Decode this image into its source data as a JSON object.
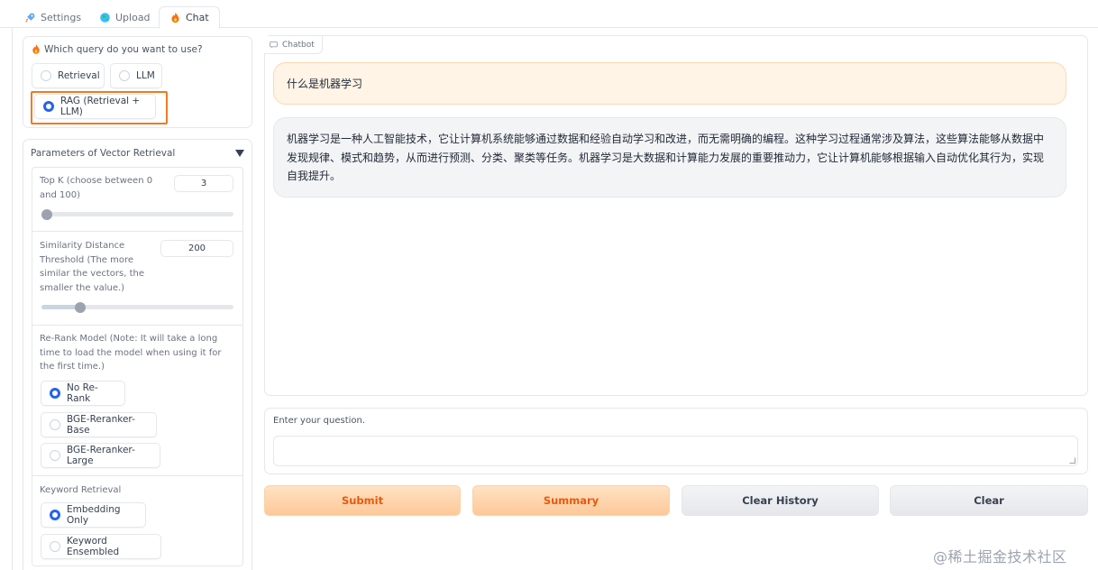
{
  "tabs": [
    {
      "label": "Settings",
      "icon": "rocket-icon",
      "active": false
    },
    {
      "label": "Upload",
      "icon": "globe-icon",
      "active": false
    },
    {
      "label": "Chat",
      "icon": "fire-icon",
      "active": true
    }
  ],
  "query": {
    "label": "Which query do you want to use?",
    "options": [
      "Retrieval",
      "LLM",
      "RAG (Retrieval + LLM)"
    ],
    "selected": "RAG (Retrieval + LLM)"
  },
  "vector_params": {
    "title": "Parameters of Vector Retrieval",
    "topk": {
      "label": "Top K (choose between 0 and 100)",
      "value": "3",
      "fraction": 0.03
    },
    "similarity": {
      "label": "Similarity Distance Threshold (The more similar the vectors, the smaller the value.)",
      "value": "200",
      "fraction": 0.2
    },
    "rerank": {
      "label": "Re-Rank Model (Note: It will take a long time to load the model when using it for the first time.)",
      "options": [
        "No Re-Rank",
        "BGE-Reranker-Base",
        "BGE-Reranker-Large"
      ],
      "selected": "No Re-Rank"
    },
    "keyword": {
      "label": "Keyword Retrieval",
      "options": [
        "Embedding Only",
        "Keyword Ensembled"
      ],
      "selected": "Embedding Only"
    }
  },
  "chatbot": {
    "label": "Chatbot",
    "user_message": "什么是机器学习",
    "bot_message": "机器学习是一种人工智能技术，它让计算机系统能够通过数据和经验自动学习和改进，而无需明确的编程。这种学习过程通常涉及算法，这些算法能够从数据中发现规律、模式和趋势，从而进行预测、分类、聚类等任务。机器学习是大数据和计算能力发展的重要推动力，它让计算机能够根据输入自动优化其行为，实现自我提升。"
  },
  "question": {
    "label": "Enter your question.",
    "value": ""
  },
  "buttons": {
    "submit": "Submit",
    "summary": "Summary",
    "clear_history": "Clear History",
    "clear": "Clear"
  },
  "watermark": "@稀土掘金技术社区",
  "colors": {
    "accent": "#ea580c",
    "radio": "#2563eb",
    "highlight": "#ee7a22",
    "user_bubble": "#fff4e6"
  }
}
